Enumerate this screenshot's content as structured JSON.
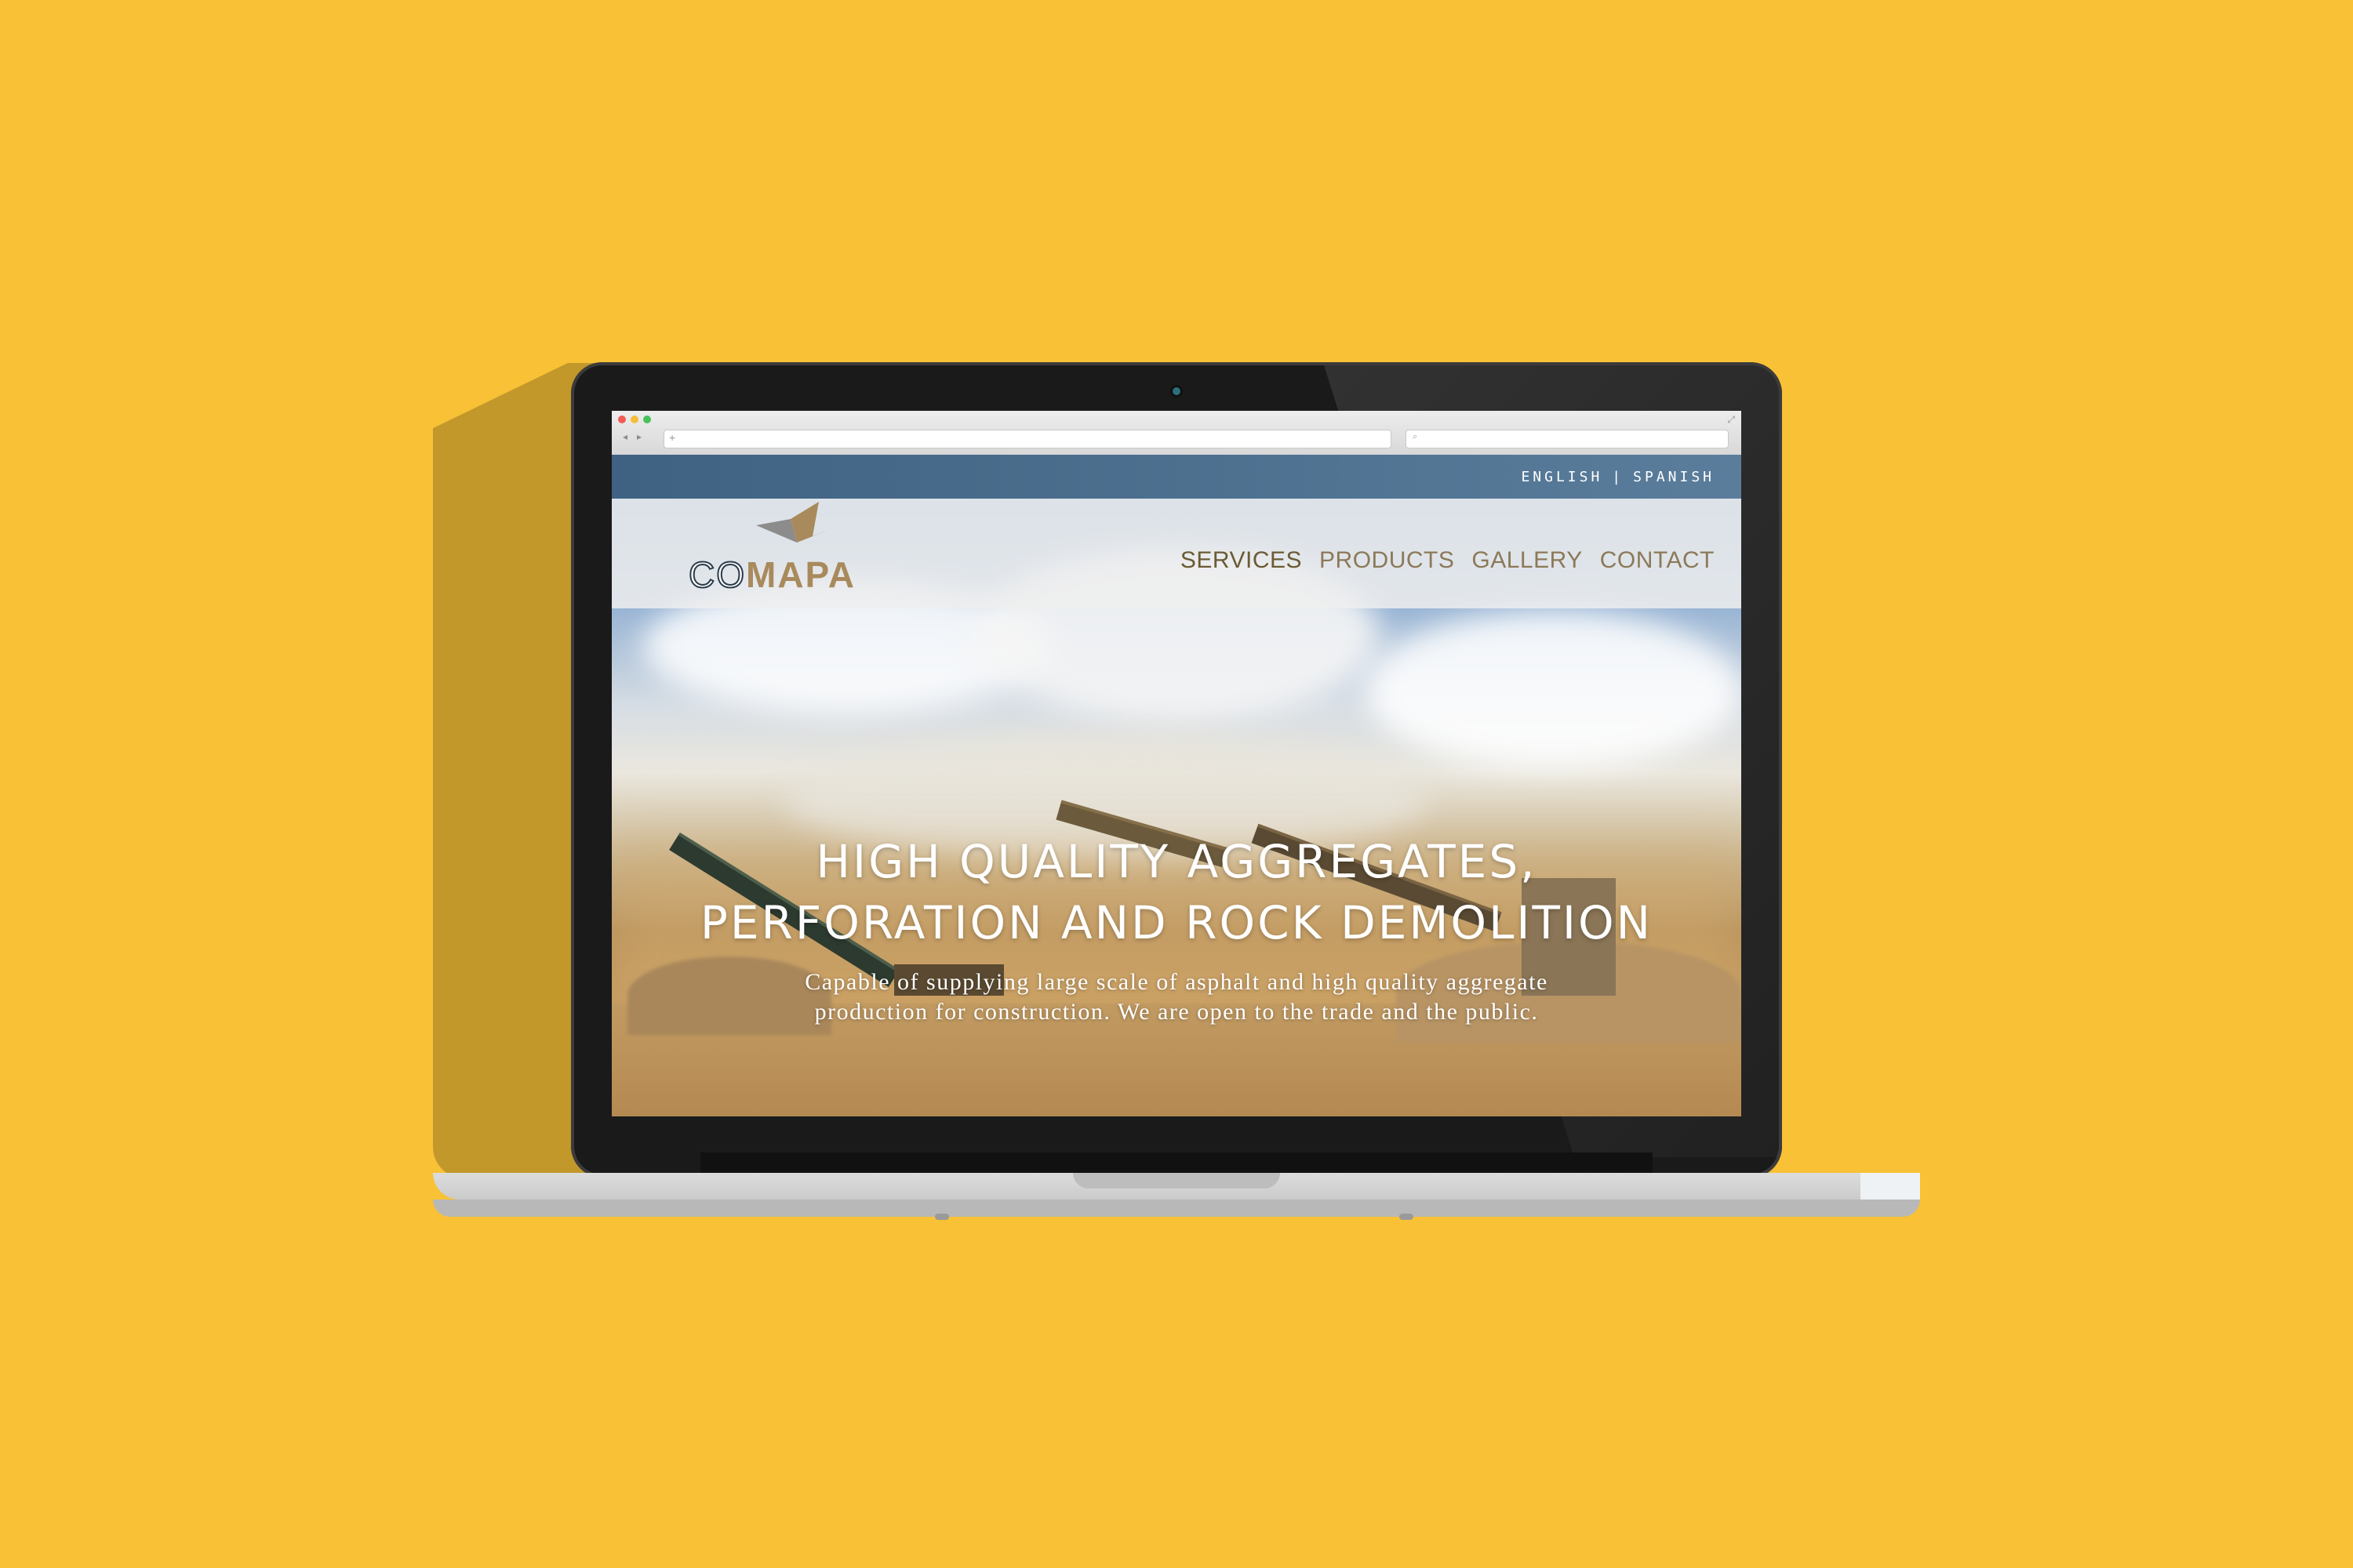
{
  "colors": {
    "background": "#F8C136",
    "brand_gold": "#A98A5C",
    "brand_navy": "#2B3B4A",
    "lang_bar": "#4A6C8C",
    "nav_text": "#8C7958"
  },
  "browser": {
    "url": "",
    "search_placeholder": "",
    "icons": {
      "close": "close-dot",
      "minimize": "minimize-dot",
      "zoom": "zoom-dot",
      "back": "back-arrow-icon",
      "forward": "forward-arrow-icon",
      "new_tab": "plus-icon",
      "search": "search-icon",
      "fullscreen": "expand-icon"
    }
  },
  "site": {
    "languages": [
      "ENGLISH",
      "SPANISH"
    ],
    "logo": {
      "part1": "CO",
      "part2": "MAPA"
    },
    "nav": [
      "SERVICES",
      "PRODUCTS",
      "GALLERY",
      "CONTACT"
    ],
    "nav_active": "SERVICES",
    "hero": {
      "title_line1": "HIGH QUALITY AGGREGATES,",
      "title_line2": "PERFORATION AND ROCK DEMOLITION",
      "subtitle_line1": "Capable of supplying large scale of asphalt and high quality aggregate",
      "subtitle_line2": "production for construction. We are open to the trade and the public."
    }
  }
}
